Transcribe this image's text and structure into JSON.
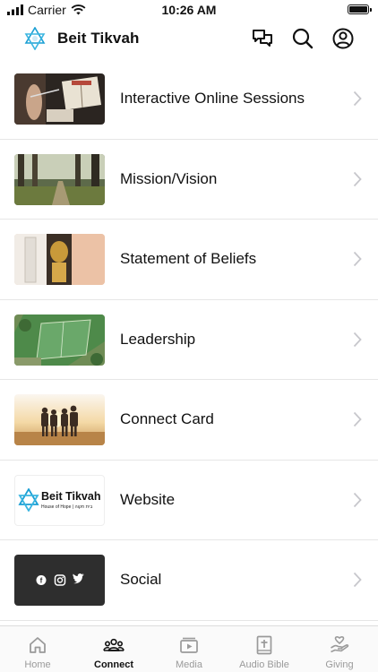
{
  "status_bar": {
    "carrier": "Carrier",
    "time": "10:26 AM"
  },
  "header": {
    "title": "Beit Tikvah"
  },
  "items": [
    {
      "label": "Interactive Online Sessions",
      "thumb": "bible-reading-photo"
    },
    {
      "label": "Mission/Vision",
      "thumb": "forest-path-photo"
    },
    {
      "label": "Statement of Beliefs",
      "thumb": "torah-scroll-photo"
    },
    {
      "label": "Leadership",
      "thumb": "aerial-field-photo"
    },
    {
      "label": "Connect Card",
      "thumb": "friends-sunset-photo"
    },
    {
      "label": "Website",
      "thumb": "beit-tikvah-logo",
      "logo_text": "Beit Tikvah",
      "logo_subtext": "House of Hope | בית תקוה"
    },
    {
      "label": "Social",
      "thumb": "social-icons-card"
    }
  ],
  "tabs": [
    {
      "label": "Home",
      "icon": "home-icon",
      "active": false
    },
    {
      "label": "Connect",
      "icon": "people-icon",
      "active": true
    },
    {
      "label": "Media",
      "icon": "media-icon",
      "active": false
    },
    {
      "label": "Audio Bible",
      "icon": "bible-icon",
      "active": false
    },
    {
      "label": "Giving",
      "icon": "giving-icon",
      "active": false
    }
  ],
  "colors": {
    "accent": "#1a9fd4",
    "divider": "#e6e6e6",
    "chevron": "#c7c7cc",
    "inactive_tab": "#9a9a9a"
  }
}
